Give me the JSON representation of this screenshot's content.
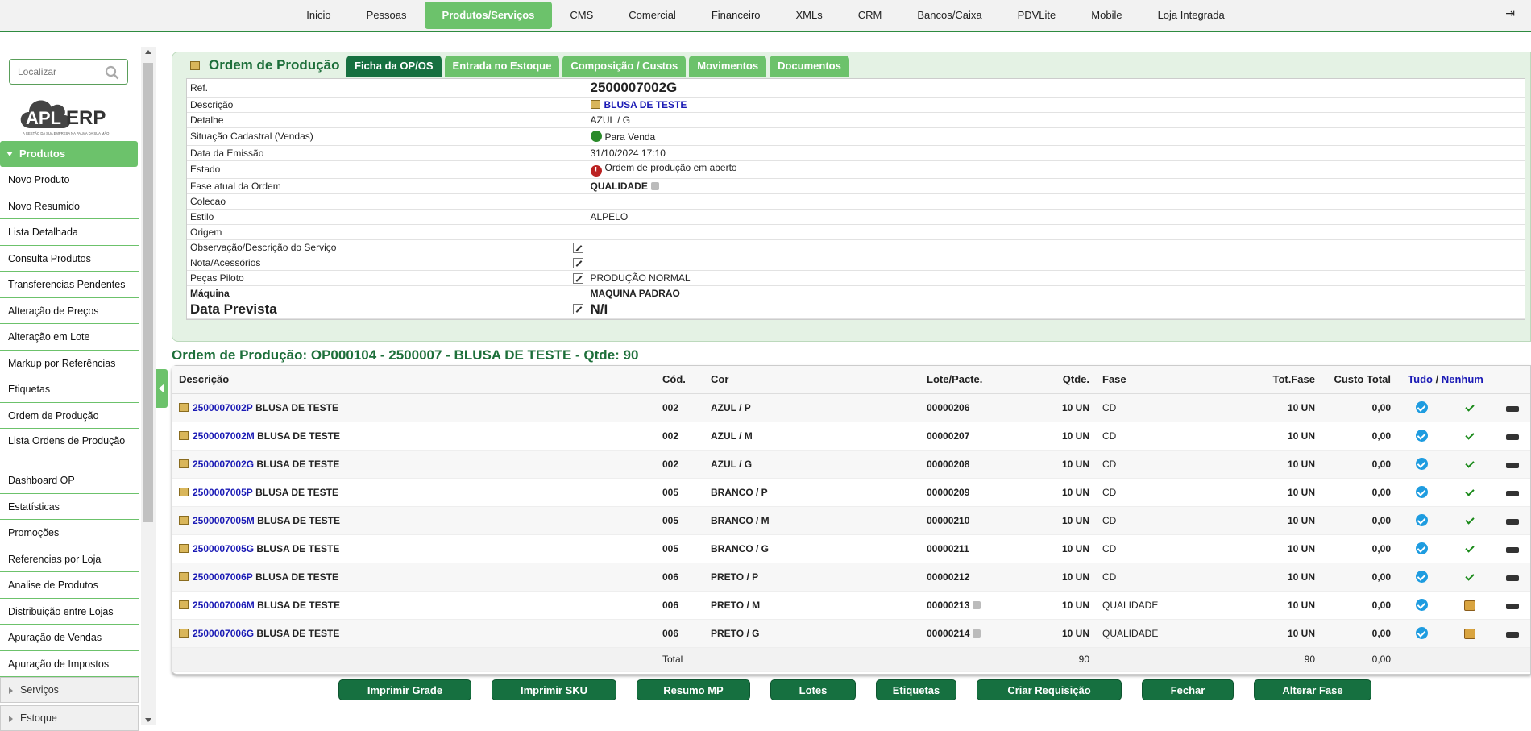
{
  "topnav": {
    "items": [
      "Inicio",
      "Pessoas",
      "Produtos/Serviços",
      "CMS",
      "Comercial",
      "Financeiro",
      "XMLs",
      "CRM",
      "Bancos/Caixa",
      "PDVLite",
      "Mobile",
      "Loja Integrada"
    ],
    "active_index": 2
  },
  "sidebar": {
    "search_placeholder": "Localizar",
    "logo_text": "APL ERP",
    "logo_tagline": "A GESTÃO DA SUA EMPRESA NA PALMA DA SUA MÃO",
    "section": "Produtos",
    "items": [
      "Novo Produto",
      "Novo Resumido",
      "Lista Detalhada",
      "Consulta Produtos",
      "Transferencias Pendentes",
      "Alteração de Preços",
      "Alteração em Lote",
      "Markup por Referências",
      "Etiquetas",
      "Ordem de Produção",
      "Lista Ordens de Produção",
      "Dashboard OP",
      "Estatísticas",
      "Promoções",
      "Referencias por Loja",
      "Analise de Produtos",
      "Distribuição entre Lojas",
      "Apuração de Vendas",
      "Apuração de Impostos"
    ],
    "subsections": [
      "Serviços",
      "Estoque"
    ]
  },
  "panel": {
    "title": "Ordem de Produção",
    "tabs": [
      "Ficha da OP/OS",
      "Entrada no Estoque",
      "Composição / Custos",
      "Movimentos",
      "Documentos"
    ],
    "active_tab": 0,
    "fields": {
      "ref_label": "Ref.",
      "ref_value": "2500007002G",
      "descricao_label": "Descrição",
      "descricao_value": "BLUSA DE TESTE",
      "detalhe_label": "Detalhe",
      "detalhe_value": "AZUL / G",
      "situacao_label": "Situação Cadastral (Vendas)",
      "situacao_value": "Para Venda",
      "emissao_label": "Data da Emissão",
      "emissao_value": "31/10/2024 17:10",
      "estado_label": "Estado",
      "estado_value": "Ordem de produção em aberto",
      "fase_label": "Fase atual da Ordem",
      "fase_value": "QUALIDADE",
      "colecao_label": "Colecao",
      "colecao_value": "",
      "estilo_label": "Estilo",
      "estilo_value": "ALPELO",
      "origem_label": "Origem",
      "origem_value": "",
      "obs_label": "Observação/Descrição do Serviço",
      "obs_value": "",
      "nota_label": "Nota/Acessórios",
      "nota_value": "",
      "pecas_label": "Peças Piloto",
      "pecas_value": "PRODUÇÃO NORMAL",
      "maquina_label": "Máquina",
      "maquina_value": "MAQUINA PADRAO",
      "prevista_label": "Data Prevista",
      "prevista_value": "N/I"
    }
  },
  "order": {
    "title": "Ordem de Produção: OP000104 - 2500007 - BLUSA DE TESTE - Qtde: 90",
    "headers": {
      "descricao": "Descrição",
      "cod": "Cód.",
      "cor": "Cor",
      "lote": "Lote/Pacte.",
      "qtde": "Qtde.",
      "fase": "Fase",
      "totfase": "Tot.Fase",
      "custo": "Custo Total",
      "tudo": "Tudo",
      "sep": "/",
      "nenhum": "Nenhum"
    },
    "rows": [
      {
        "code": "2500007002P",
        "desc": "BLUSA DE TESTE",
        "cod": "002",
        "cor": "AZUL / P",
        "lote": "00000206",
        "qtde": "10 UN",
        "fase": "CD",
        "tot": "10 UN",
        "custo": "0,00",
        "status": "done"
      },
      {
        "code": "2500007002M",
        "desc": "BLUSA DE TESTE",
        "cod": "002",
        "cor": "AZUL / M",
        "lote": "00000207",
        "qtde": "10 UN",
        "fase": "CD",
        "tot": "10 UN",
        "custo": "0,00",
        "status": "done"
      },
      {
        "code": "2500007002G",
        "desc": "BLUSA DE TESTE",
        "cod": "002",
        "cor": "AZUL / G",
        "lote": "00000208",
        "qtde": "10 UN",
        "fase": "CD",
        "tot": "10 UN",
        "custo": "0,00",
        "status": "done"
      },
      {
        "code": "2500007005P",
        "desc": "BLUSA DE TESTE",
        "cod": "005",
        "cor": "BRANCO / P",
        "lote": "00000209",
        "qtde": "10 UN",
        "fase": "CD",
        "tot": "10 UN",
        "custo": "0,00",
        "status": "done"
      },
      {
        "code": "2500007005M",
        "desc": "BLUSA DE TESTE",
        "cod": "005",
        "cor": "BRANCO / M",
        "lote": "00000210",
        "qtde": "10 UN",
        "fase": "CD",
        "tot": "10 UN",
        "custo": "0,00",
        "status": "done"
      },
      {
        "code": "2500007005G",
        "desc": "BLUSA DE TESTE",
        "cod": "005",
        "cor": "BRANCO / G",
        "lote": "00000211",
        "qtde": "10 UN",
        "fase": "CD",
        "tot": "10 UN",
        "custo": "0,00",
        "status": "done"
      },
      {
        "code": "2500007006P",
        "desc": "BLUSA DE TESTE",
        "cod": "006",
        "cor": "PRETO / P",
        "lote": "00000212",
        "qtde": "10 UN",
        "fase": "CD",
        "tot": "10 UN",
        "custo": "0,00",
        "status": "done"
      },
      {
        "code": "2500007006M",
        "desc": "BLUSA DE TESTE",
        "cod": "006",
        "cor": "PRETO / M",
        "lote": "00000213",
        "qtde": "10 UN",
        "fase": "QUALIDADE",
        "tot": "10 UN",
        "custo": "0,00",
        "status": "pending"
      },
      {
        "code": "2500007006G",
        "desc": "BLUSA DE TESTE",
        "cod": "006",
        "cor": "PRETO / G",
        "lote": "00000214",
        "qtde": "10 UN",
        "fase": "QUALIDADE",
        "tot": "10 UN",
        "custo": "0,00",
        "status": "pending"
      }
    ],
    "total": {
      "label": "Total",
      "qtde": "90",
      "tot": "90",
      "custo": "0,00"
    }
  },
  "buttons": [
    "Imprimir Grade",
    "Imprimir SKU",
    "Resumo MP",
    "Lotes",
    "Etiquetas",
    "Criar Requisição",
    "Fechar",
    "Alterar Fase"
  ],
  "colors": {
    "accent": "#6cc26b",
    "dark": "#167040",
    "title": "#1d6f3a",
    "link": "#1a1ab5"
  }
}
